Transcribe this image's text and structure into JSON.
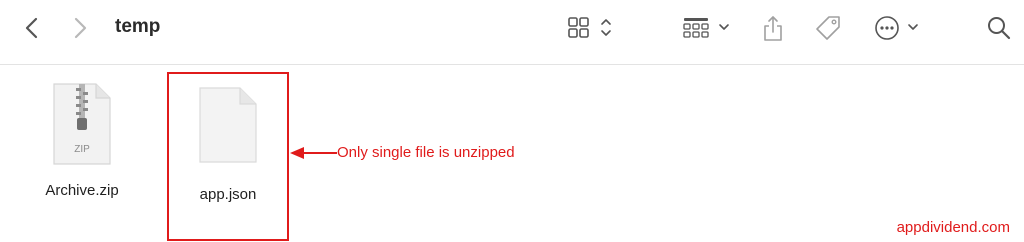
{
  "window": {
    "title": "temp"
  },
  "toolbar": {
    "back_icon": "chevron-left-icon",
    "forward_icon": "chevron-right-icon",
    "view_icon": "icon-grid-view-icon",
    "group_icon": "group-by-icon",
    "share_icon": "share-icon",
    "tag_icon": "tag-icon",
    "more_icon": "ellipsis-circle-icon",
    "search_icon": "search-icon"
  },
  "files": [
    {
      "name": "Archive.zip",
      "type": "zip",
      "badge": "ZIP"
    },
    {
      "name": "app.json",
      "type": "document"
    }
  ],
  "annotation": {
    "text": "Only single file is unzipped",
    "color": "#e01b1b"
  },
  "watermark": {
    "text": "appdividend.com"
  }
}
